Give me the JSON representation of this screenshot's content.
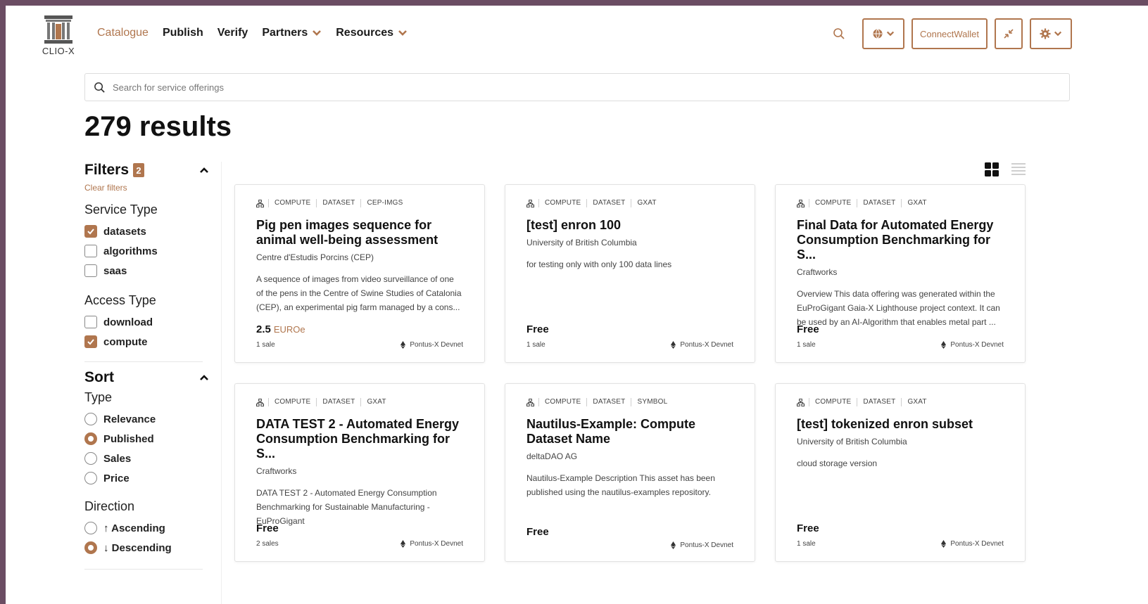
{
  "brand": {
    "name": "CLIO-X"
  },
  "nav": [
    {
      "label": "Catalogue",
      "active": true,
      "dropdown": false
    },
    {
      "label": "Publish",
      "active": false,
      "dropdown": false
    },
    {
      "label": "Verify",
      "active": false,
      "dropdown": false
    },
    {
      "label": "Partners",
      "active": false,
      "dropdown": true
    },
    {
      "label": "Resources",
      "active": false,
      "dropdown": true
    }
  ],
  "header_actions": {
    "search_icon": "search-icon",
    "network_icon": "globe-icon",
    "connect_label": "ConnectWallet",
    "compact_icon": "collapse-arrows-icon",
    "settings_icon": "gear-icon"
  },
  "search": {
    "placeholder": "Search for service offerings",
    "value": ""
  },
  "results": {
    "title": "279 results"
  },
  "filters": {
    "title": "Filters",
    "count": "2",
    "clear_label": "Clear filters",
    "service_type": {
      "title": "Service Type",
      "options": [
        {
          "label": "datasets",
          "checked": true
        },
        {
          "label": "algorithms",
          "checked": false
        },
        {
          "label": "saas",
          "checked": false
        }
      ]
    },
    "access_type": {
      "title": "Access Type",
      "options": [
        {
          "label": "download",
          "checked": false
        },
        {
          "label": "compute",
          "checked": true
        }
      ]
    }
  },
  "sort": {
    "title": "Sort",
    "type": {
      "title": "Type",
      "options": [
        {
          "label": "Relevance",
          "checked": false
        },
        {
          "label": "Published",
          "checked": true
        },
        {
          "label": "Sales",
          "checked": false
        },
        {
          "label": "Price",
          "checked": false
        }
      ]
    },
    "direction": {
      "title": "Direction",
      "options": [
        {
          "label": "↑ Ascending",
          "checked": false
        },
        {
          "label": "↓ Descending",
          "checked": true
        }
      ]
    }
  },
  "view": {
    "mode": "grid"
  },
  "cards": [
    {
      "tags": [
        "COMPUTE",
        "DATASET",
        "CEP-IMGS"
      ],
      "title": "Pig pen images sequence for\nanimal well-being assessment",
      "publisher": "Centre d'Estudis Porcins (CEP)",
      "description": "A sequence of images from video surveillance of one of the pens in the Centre of Swine Studies of Catalonia (CEP), an experimental pig farm managed by a cons...",
      "price": "2.5",
      "price_unit": "EUROe",
      "sales": "1 sale",
      "network": "Pontus-X Devnet"
    },
    {
      "tags": [
        "COMPUTE",
        "DATASET",
        "GXAT"
      ],
      "title": "[test] enron 100",
      "publisher": "University of British Columbia",
      "description": "for testing only with only 100 data lines",
      "price": "Free",
      "price_unit": "",
      "sales": "1 sale",
      "network": "Pontus-X Devnet"
    },
    {
      "tags": [
        "COMPUTE",
        "DATASET",
        "GXAT"
      ],
      "title": "Final Data for Automated Energy\nConsumption Benchmarking for S...",
      "publisher": "Craftworks",
      "description": "Overview This data offering was generated within the EuProGigant Gaia-X Lighthouse project context. It can be used by an AI-Algorithm that enables metal part ...",
      "price": "Free",
      "price_unit": "",
      "sales": "1 sale",
      "network": "Pontus-X Devnet"
    },
    {
      "tags": [
        "COMPUTE",
        "DATASET",
        "GXAT"
      ],
      "title": "DATA TEST 2 - Automated Energy\nConsumption Benchmarking for S...",
      "publisher": "Craftworks",
      "description": "DATA TEST 2 - Automated Energy Consumption Benchmarking for Sustainable Manufacturing - EuProGigant",
      "price": "Free",
      "price_unit": "",
      "sales": "2 sales",
      "network": "Pontus-X Devnet"
    },
    {
      "tags": [
        "COMPUTE",
        "DATASET",
        "SYMBOL"
      ],
      "title": "Nautilus-Example: Compute\nDataset Name",
      "publisher": "deltaDAO AG",
      "description": "Nautilus-Example Description This asset has been published using the nautilus-examples repository.",
      "price": "Free",
      "price_unit": "",
      "sales": "",
      "network": "Pontus-X Devnet"
    },
    {
      "tags": [
        "COMPUTE",
        "DATASET",
        "GXAT"
      ],
      "title": "[test] tokenized enron subset",
      "publisher": "University of British Columbia",
      "description": "cloud storage version",
      "price": "Free",
      "price_unit": "",
      "sales": "1 sale",
      "network": "Pontus-X Devnet"
    }
  ],
  "colors": {
    "accent": "#b0764e",
    "frame": "#6b4d63"
  }
}
